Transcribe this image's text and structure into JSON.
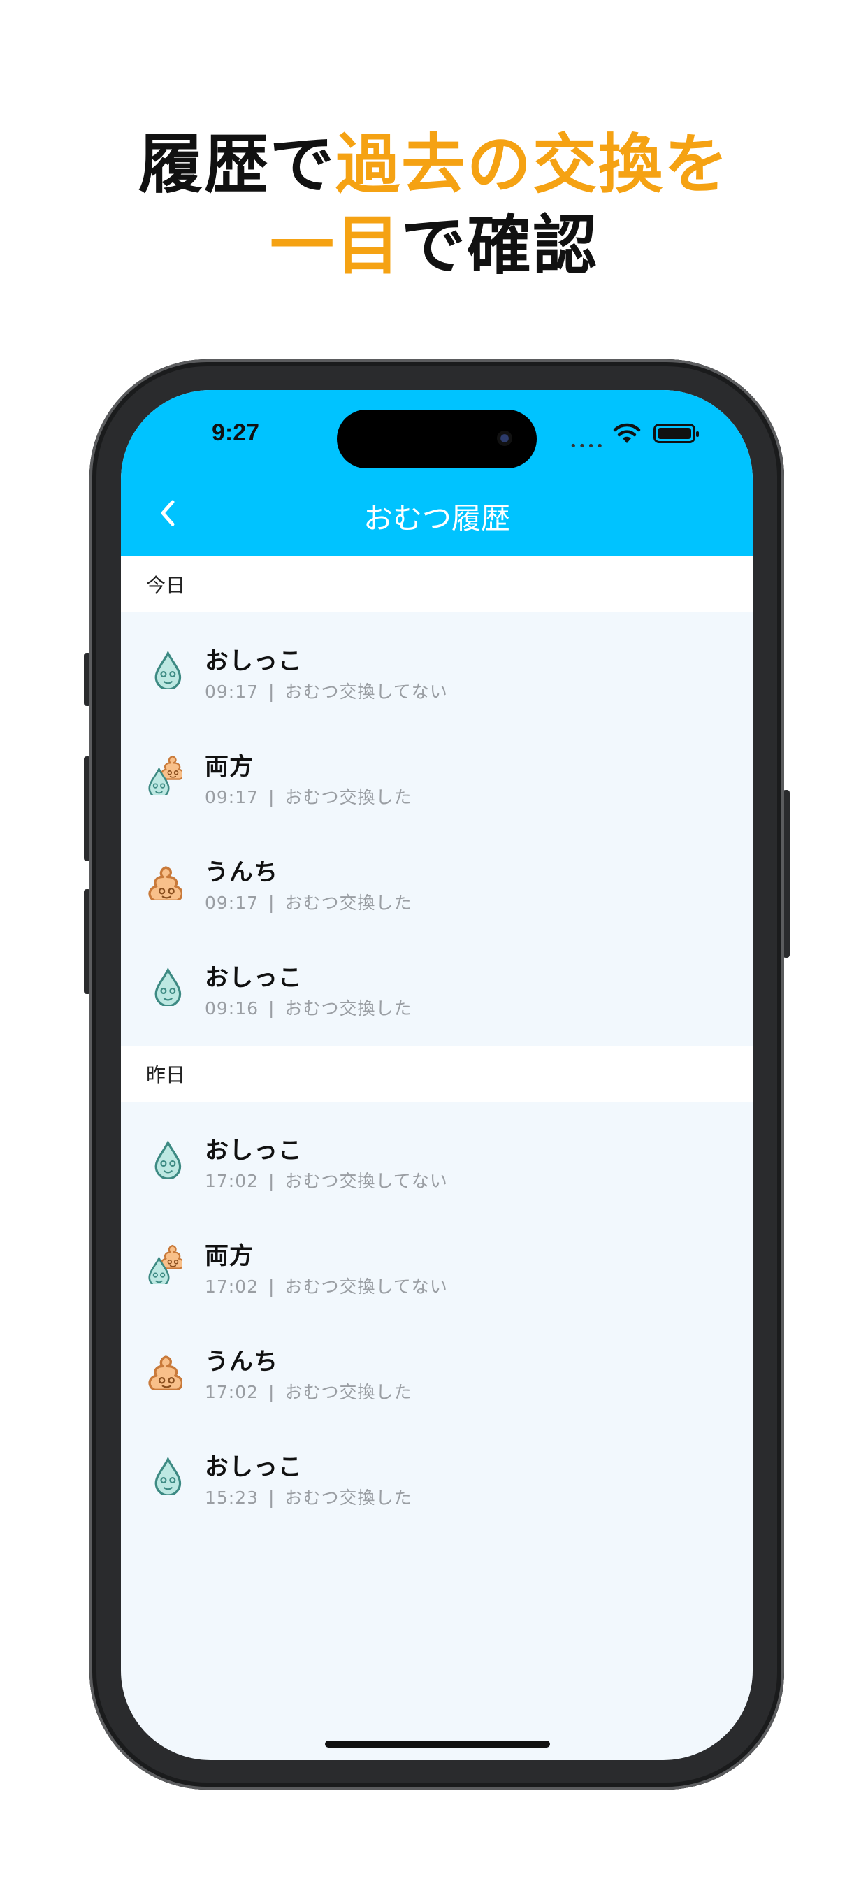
{
  "promo": {
    "line1_a": "履歴で",
    "line1_b": "過去の交換を",
    "line2_a": "一目",
    "line2_b": "で確認",
    "colors": {
      "dark": "#111111",
      "accent": "#F5A213"
    }
  },
  "status_bar": {
    "time": "9:27",
    "background": "#00C3FF"
  },
  "nav": {
    "title": "おむつ履歴",
    "back_icon": "chevron-left-icon"
  },
  "sections": [
    {
      "header": "今日",
      "rows": [
        {
          "type": "pee",
          "title": "おしっこ",
          "time": "09:17",
          "sep": "|",
          "status": "おむつ交換してない"
        },
        {
          "type": "both",
          "title": "両方",
          "time": "09:17",
          "sep": "|",
          "status": "おむつ交換した"
        },
        {
          "type": "poop",
          "title": "うんち",
          "time": "09:17",
          "sep": "|",
          "status": "おむつ交換した"
        },
        {
          "type": "pee",
          "title": "おしっこ",
          "time": "09:16",
          "sep": "|",
          "status": "おむつ交換した"
        }
      ]
    },
    {
      "header": "昨日",
      "rows": [
        {
          "type": "pee",
          "title": "おしっこ",
          "time": "17:02",
          "sep": "|",
          "status": "おむつ交換してない"
        },
        {
          "type": "both",
          "title": "両方",
          "time": "17:02",
          "sep": "|",
          "status": "おむつ交換してない"
        },
        {
          "type": "poop",
          "title": "うんち",
          "time": "17:02",
          "sep": "|",
          "status": "おむつ交換した"
        },
        {
          "type": "pee",
          "title": "おしっこ",
          "time": "15:23",
          "sep": "|",
          "status": "おむつ交換した"
        }
      ]
    }
  ],
  "icons": {
    "pee": "water-drop-icon",
    "poop": "poop-icon",
    "both": "drop-and-poop-icon"
  }
}
